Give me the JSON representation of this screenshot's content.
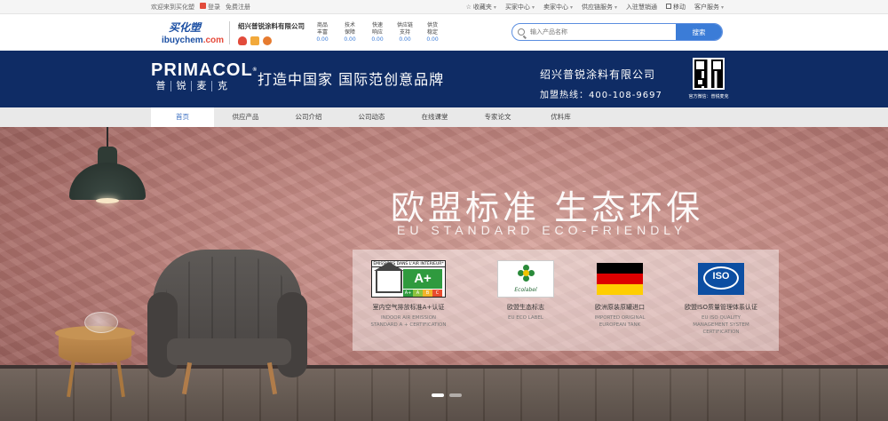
{
  "topbar": {
    "welcome": "欢迎来到买化塑",
    "login": "登录",
    "register": "免费注册",
    "right_items": [
      {
        "label": "收藏夹",
        "type": "star"
      },
      {
        "label": "买家中心",
        "type": "caret"
      },
      {
        "label": "卖家中心",
        "type": "caret"
      },
      {
        "label": "供应链服务",
        "type": "caret"
      },
      {
        "label": "入驻慧销通",
        "type": "plain"
      },
      {
        "label": "移动",
        "type": "box"
      },
      {
        "label": "客户服务",
        "type": "caret"
      }
    ]
  },
  "header": {
    "logo_cn": "买化塑",
    "logo_en_a": "ibuychem",
    "logo_en_b": ".com",
    "company_name": "绍兴普锐涂料有限公司",
    "stats": [
      {
        "label1": "商品",
        "label2": "丰富",
        "value": "0.00"
      },
      {
        "label1": "技术",
        "label2": "保障",
        "value": "0.00"
      },
      {
        "label1": "快速",
        "label2": "响应",
        "value": "0.00"
      },
      {
        "label1": "供应链",
        "label2": "支持",
        "value": "0.00"
      },
      {
        "label1": "供货",
        "label2": "稳定",
        "value": "0.00"
      }
    ],
    "search_placeholder": "输入产品名称",
    "search_button": "搜索"
  },
  "banner": {
    "brand_en": "PRIMACOL",
    "brand_reg": "®",
    "brand_cn": [
      "普",
      "锐",
      "麦",
      "克"
    ],
    "slogan": "打造中国家  国际范创意品牌",
    "company": "绍兴普锐涂料有限公司",
    "hotline": "加盟热线：400-108-9697",
    "qr_caption": "官方微信：普锐麦克"
  },
  "nav": {
    "items": [
      "首页",
      "供应产品",
      "公司介绍",
      "公司动态",
      "在线课堂",
      "专家论文",
      "优料库"
    ],
    "active_index": 0
  },
  "hero": {
    "title": "欧盟标准  生态环保",
    "subtitle": "EU STANDARD   ECO-FRIENDLY",
    "certs": [
      {
        "cn": "室内空气排放标准A+认证",
        "en1": "INDOOR AIR EMISSION",
        "en2": "STANDARD A + CERTIFICATION",
        "logo": "aplus-icon",
        "top_text": "ÉMISSIONS DANS L'AIR INTÉRIEUR*",
        "grade": "A+",
        "scale": [
          "A+",
          "A",
          "B",
          "C"
        ]
      },
      {
        "cn": "欧盟生态标志",
        "en1": "EU ECO LABEL",
        "en2": "",
        "logo": "ecolabel-icon",
        "label_text": "Ecolabel"
      },
      {
        "cn": "欧洲原装原罐进口",
        "en1": "IMPORTED ORIGINAL",
        "en2": "EUROPEAN TANK",
        "logo": "german-flag-icon"
      },
      {
        "cn": "欧盟ISO质量管理体系认证",
        "en1": "EU ISO QUALITY",
        "en2": "MANAGEMENT SYSTEM",
        "en3": "CERTIFICATION",
        "logo": "iso-icon",
        "iso_text": "ISO"
      }
    ],
    "slides": 2,
    "active_slide": 0
  },
  "colors": {
    "banner_bg": "#0f2c65",
    "accent_blue": "#3b7cd7",
    "nav_bg": "#e9e9e9"
  }
}
